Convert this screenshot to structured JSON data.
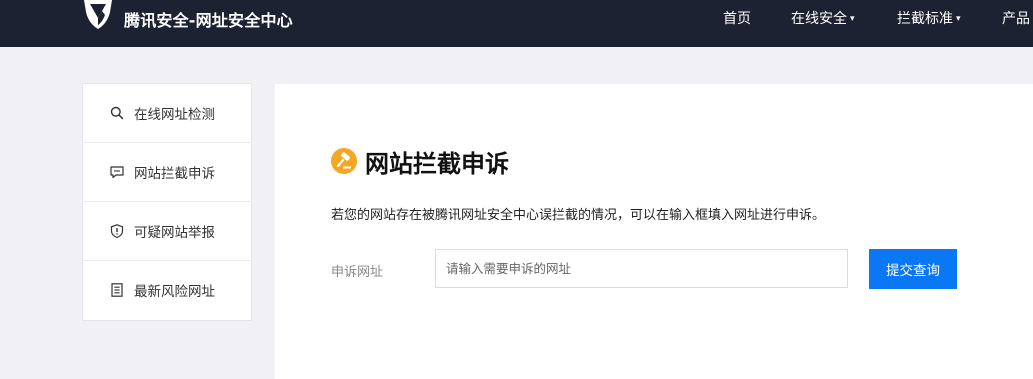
{
  "header": {
    "brand": "腾讯安全-网址安全中心",
    "logo_icon": "tencent-shield-logo",
    "nav": [
      {
        "label": "首页",
        "has_dropdown": false
      },
      {
        "label": "在线安全",
        "has_dropdown": true
      },
      {
        "label": "拦截标准",
        "has_dropdown": true
      },
      {
        "label": "产品",
        "has_dropdown": false
      }
    ],
    "caret": "▾"
  },
  "sidebar": {
    "items": [
      {
        "label": "在线网址检测",
        "icon": "search-icon"
      },
      {
        "label": "网站拦截申诉",
        "icon": "chat-icon"
      },
      {
        "label": "可疑网站举报",
        "icon": "shield-alert-icon"
      },
      {
        "label": "最新风险网址",
        "icon": "list-document-icon"
      }
    ]
  },
  "main": {
    "title": "网站拦截申诉",
    "title_icon": "gavel-icon",
    "description": "若您的网站存在被腾讯网址安全中心误拦截的情况，可以在输入框填入网址进行申诉。",
    "field_label": "申诉网址",
    "input_placeholder": "请输入需要申诉的网址",
    "input_value": "",
    "submit_label": "提交查询"
  },
  "colors": {
    "header_bg": "#1d2232",
    "page_bg": "#f1f1f5",
    "accent_blue": "#0a78f5",
    "title_icon_orange": "#f5a623"
  }
}
